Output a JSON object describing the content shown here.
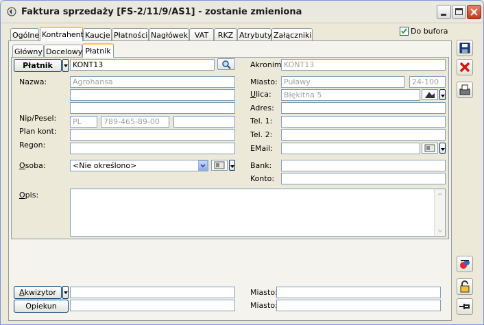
{
  "window": {
    "title": "Faktura sprzedaży [FS-2/11/9/AS1]  - zostanie zmieniona"
  },
  "tabs": [
    "Ogólne",
    "Kontrahent",
    "Kaucje",
    "Płatności",
    "Nagłówek",
    "VAT",
    "RKZ",
    "Atrybuty",
    "Załączniki"
  ],
  "subtabs": [
    "Główny",
    "Docelowy",
    "Płatnik"
  ],
  "do_bufora": {
    "label": "Do bufora",
    "checked": true
  },
  "platnik": {
    "button": "Płatnik",
    "code": "KONT13"
  },
  "labels": {
    "nazwa": "Nazwa:",
    "nip": "Nip/Pesel:",
    "plan": "Plan kont:",
    "regon": "Regon:",
    "osoba": "Osoba:",
    "opis": "Opis:",
    "akronim": "Akronim:",
    "miasto": "Miasto:",
    "ulica": "Ulica:",
    "adres": "Adres:",
    "tel1": "Tel. 1:",
    "tel2": "Tel. 2:",
    "email": "EMail:",
    "bank": "Bank:",
    "konto": "Konto:",
    "miasto2": "Miasto:",
    "miasto3": "Miasto:"
  },
  "values": {
    "nazwa1": "Agrohansa",
    "nip_prefix": "PL",
    "nip": "789-465-89-00",
    "osoba": "<Nie określono>",
    "akronim": "KONT13",
    "miasto": "Puławy",
    "kod": "24-100",
    "ulica": "Błękitna 5"
  },
  "bottom": {
    "akwizytor": "Akwizytor",
    "opiekun": "Opiekun"
  },
  "icons": {
    "save": "save-icon",
    "cancel": "cancel-icon",
    "print": "print-icon",
    "calc": "calculate-icon",
    "lock": "lock-icon",
    "pin": "pin-icon"
  }
}
